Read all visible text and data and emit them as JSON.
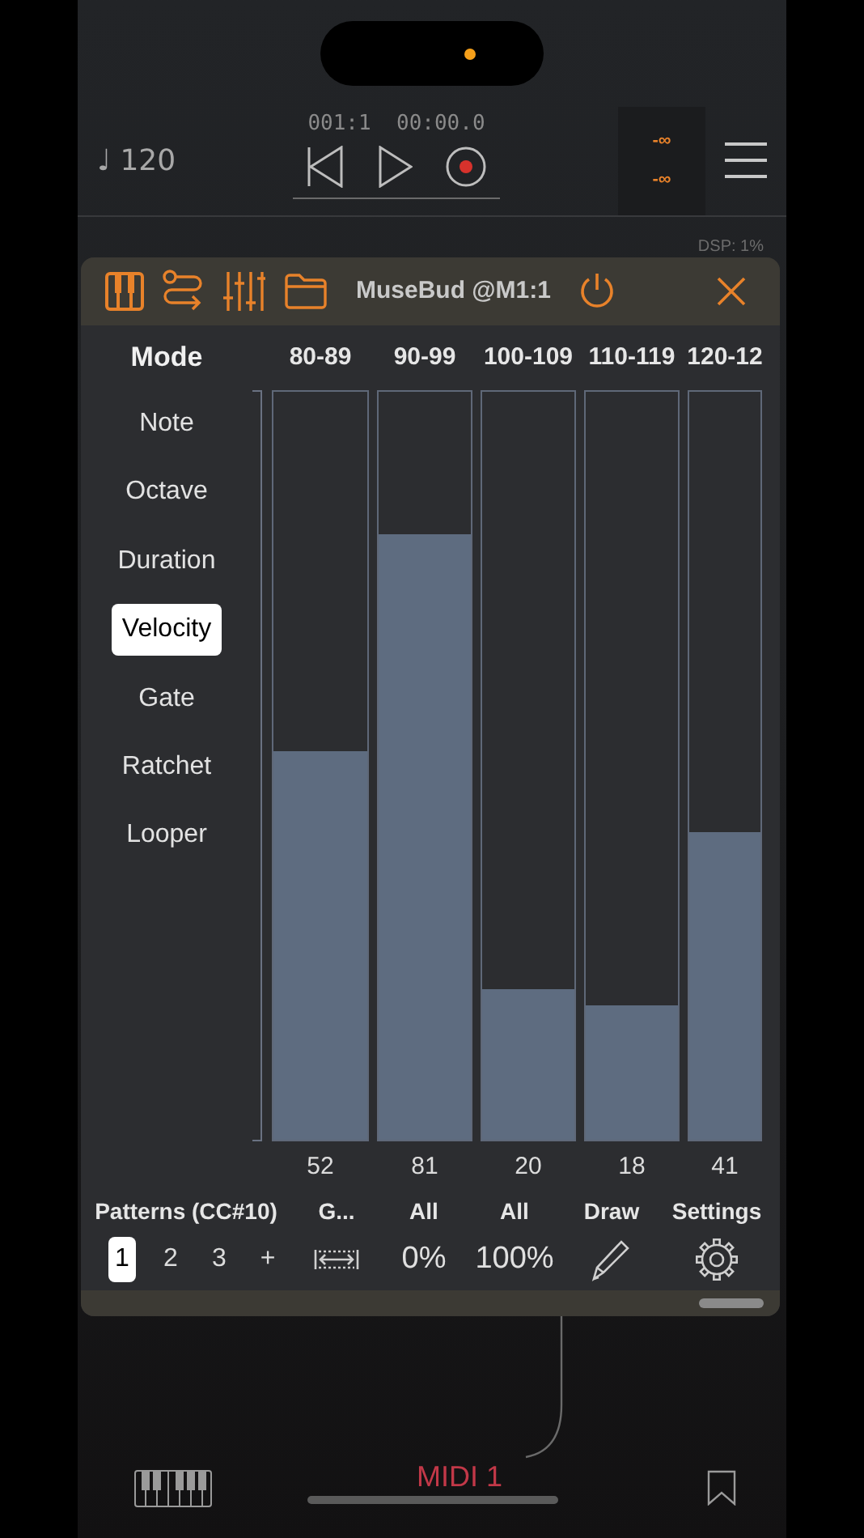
{
  "transport": {
    "position": "001:1  00:00.0",
    "tempo": "♩ 120",
    "meter": [
      "-∞",
      "-∞"
    ],
    "dsp": "DSP: 1%"
  },
  "plugin": {
    "title": "MuseBud @M1:1",
    "mode_header": "Mode",
    "modes": [
      {
        "label": "Note",
        "selected": false
      },
      {
        "label": "Octave",
        "selected": false
      },
      {
        "label": "Duration",
        "selected": false
      },
      {
        "label": "Velocity",
        "selected": true
      },
      {
        "label": "Gate",
        "selected": false
      },
      {
        "label": "Ratchet",
        "selected": false
      },
      {
        "label": "Looper",
        "selected": false
      }
    ],
    "columns": [
      {
        "header": "80-89",
        "level": 0.52,
        "value": "52"
      },
      {
        "header": "90-99",
        "level": 0.81,
        "value": "81"
      },
      {
        "header": "100-109",
        "level": 0.2,
        "value": "20"
      },
      {
        "header": "110-119",
        "level": 0.18,
        "value": "18"
      },
      {
        "header": "120-12",
        "level": 0.41,
        "value": "41"
      }
    ],
    "patterns_label": "Patterns (CC#10)",
    "patterns": [
      {
        "label": "1",
        "selected": true
      },
      {
        "label": "2",
        "selected": false
      },
      {
        "label": "3",
        "selected": false
      },
      {
        "label": "+",
        "selected": false
      }
    ],
    "tools": [
      {
        "label": "G...",
        "kind": "icon"
      },
      {
        "label": "All",
        "kind": "text",
        "value": "0%"
      },
      {
        "label": "All",
        "kind": "text",
        "value": "100%"
      },
      {
        "label": "Draw",
        "kind": "icon"
      },
      {
        "label": "Settings",
        "kind": "icon"
      }
    ]
  },
  "bottom": {
    "track": "MIDI 1"
  }
}
